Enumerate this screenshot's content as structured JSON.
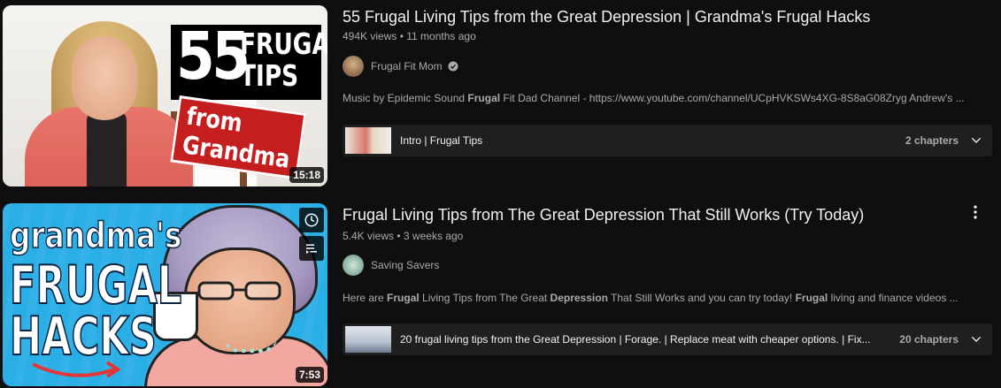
{
  "videos": [
    {
      "title": "55 Frugal Living Tips from the Great Depression | Grandma's Frugal Hacks",
      "views": "494K views",
      "age": "11 months ago",
      "channel": "Frugal Fit Mom",
      "verified": true,
      "description_parts": [
        "Music by Epidemic Sound ",
        "Frugal",
        " Fit Dad Channel - https://www.youtube.com/channel/UCpHVKSWs4XG-8S8aG08Zryg Andrew's ..."
      ],
      "duration": "15:18",
      "thumb_text": {
        "number": "55",
        "line1": "FRUGAL",
        "line2": "TIPS",
        "banner": "from Grandma"
      },
      "chapter_title": "Intro | Frugal Tips",
      "chapter_count": "2 chapters"
    },
    {
      "title": "Frugal Living Tips from The Great Depression That Still Works (Try Today)",
      "views": "5.4K views",
      "age": "3 weeks ago",
      "channel": "Saving Savers",
      "verified": false,
      "description_parts": [
        "Here are ",
        "Frugal",
        " Living Tips from The Great ",
        "Depression",
        " That Still Works and you can try today! ",
        "Frugal",
        " living and finance videos ..."
      ],
      "duration": "7:53",
      "thumb_text": {
        "line1": "grandma's",
        "line2": "FRUGAL",
        "line3": "HACKS"
      },
      "chapter_title": "20 frugal living tips from the Great Depression | Forage. | Replace meat with cheaper options. | Fix...",
      "chapter_count": "20 chapters"
    }
  ],
  "meta_separator": "•",
  "icons": {
    "verified": "verified-check-icon",
    "chevron": "chevron-down-icon",
    "more": "more-vert-icon",
    "watch_later": "clock-icon",
    "add_queue": "queue-icon"
  }
}
